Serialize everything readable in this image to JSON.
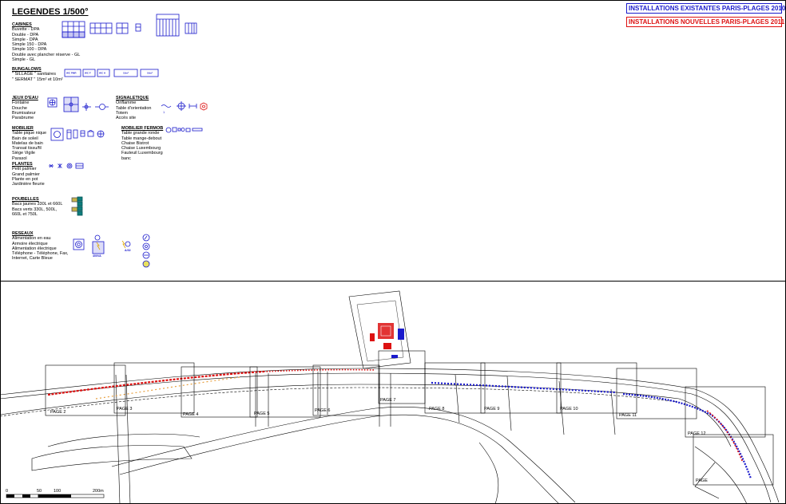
{
  "legend": {
    "title": "LEGENDES 1/500°",
    "sections": {
      "cabines": {
        "heading": "CABINES",
        "items": [
          "Buvette - DPA",
          "Double - DPA",
          "Simple - DPA",
          "Simple 150 - DPA",
          "Simple 100 - DPA",
          "Double avec plancher réserve - GL",
          "Simple - GL"
        ]
      },
      "bungalows": {
        "heading": "BUNGALOWS",
        "items": [
          "\" SILLAGE \" sanitaires",
          "\" SERMAT \" 15m² et 10m²"
        ]
      },
      "bungalow_labels": [
        "WC PMR",
        "WC F",
        "WC H",
        "15m²",
        "10m²"
      ],
      "jeux": {
        "heading": "JEUX D'EAU",
        "items": [
          "Fontaine",
          "Douche",
          "Brumisateur",
          "Parabrume"
        ]
      },
      "signaletique": {
        "heading": "SIGNALETIQUE",
        "items": [
          "Oriflamme",
          "Table d'orientation",
          "Totem",
          "Accès site"
        ]
      },
      "mobilier": {
        "heading": "MOBILIER",
        "items": [
          "Table pique nique",
          "Bain de soleil",
          "Matelas de bain",
          "Transat tissu/fil",
          "Siège Vigile",
          "Parasol"
        ]
      },
      "mobilier_fermob": {
        "heading": "MOBILIER FERMOB",
        "items": [
          "Table grande ronde",
          "Table mange-debout",
          "Chaise Bistrot",
          "Chaise Luxembourg",
          "Fauteuil Luxembourg",
          "banc"
        ]
      },
      "plantes": {
        "heading": "PLANTES",
        "items": [
          "Petit palmier",
          "Grand palmier",
          "Plante en pot",
          "Jardinière fleurie"
        ]
      },
      "poubelles": {
        "heading": "POUBELLES",
        "items": [
          "Bacs jaunes 330L et 660L",
          "Bacs verts 330L, 500L,",
          "660L et 750L"
        ]
      },
      "reseaux": {
        "heading": "RESEAUX",
        "items": [
          "Alimentation en eau",
          "Armoire électrique",
          "Alimentation électrique",
          "Téléphone - Téléphone, Fax,",
          "Internet, Carte Bleue"
        ]
      },
      "reseaux_labels": [
        "400VA",
        "A/32"
      ]
    }
  },
  "badges": {
    "existing": "INSTALLATIONS EXISTANTES PARIS-PLAGES 2010",
    "new": "INSTALLATIONS NOUVELLES PARIS-PLAGES 2011"
  },
  "colors": {
    "existing": "#1a1acc",
    "new": "#dd1111",
    "line": "#000000",
    "symbol": "#1a1acc"
  },
  "pages": [
    "PAGE 2",
    "PAGE 3",
    "PAGE 4",
    "PAGE 5",
    "PAGE 6",
    "PAGE 7",
    "PAGE 8",
    "PAGE 9",
    "PAGE 10",
    "PAGE 11",
    "PAGE 12",
    "PAGE"
  ],
  "scale": {
    "labels": [
      "0",
      "50",
      "100",
      "200m"
    ]
  }
}
